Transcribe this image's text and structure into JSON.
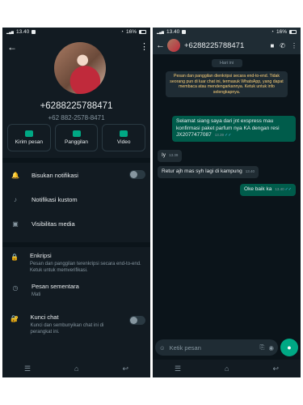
{
  "left": {
    "status": {
      "time": "13.40",
      "battery": "16%"
    },
    "contact": {
      "phone": "+6288225788471",
      "phone_alt": "+62 882-2578-8471"
    },
    "actions": [
      {
        "label": "Kirim pesan",
        "icon": "message-icon"
      },
      {
        "label": "Panggilan",
        "icon": "phone-icon"
      },
      {
        "label": "Video",
        "icon": "video-icon"
      }
    ],
    "settings": [
      {
        "label": "Bisukan notifikasi",
        "icon": "bell-icon",
        "toggle": true
      },
      {
        "label": "Notifikasi kustom",
        "icon": "music-note-icon"
      },
      {
        "label": "Visibilitas media",
        "icon": "image-icon"
      }
    ],
    "security": [
      {
        "label": "Enkripsi",
        "sub": "Pesan dan panggilan terenkripsi secara end-to-end. Ketuk untuk memverifikasi.",
        "icon": "lock-icon"
      },
      {
        "label": "Pesan sementara",
        "sub": "Mati",
        "icon": "timer-icon"
      },
      {
        "label": "Kunci chat",
        "sub": "Kunci dan sembunyikan chat ini di perangkat ini.",
        "icon": "chat-lock-icon",
        "toggle": true
      }
    ]
  },
  "right": {
    "status": {
      "time": "13.40",
      "battery": "16%"
    },
    "header": {
      "name": "+6288225788471"
    },
    "day_label": "Hari ini",
    "e2e_notice": "Pesan dan panggilan dienkripsi secara end-to-end. Tidak seorang pun di luar chat ini, termasuk WhatsApp, yang dapat membaca atau mendengarkannya. Ketuk untuk info selengkapnya.",
    "messages": [
      {
        "dir": "out",
        "text": "Selamat siang saya dari jnt exspress mau konfirmasi paket parfum nya KA dengan resi JX2077477087",
        "time": "13.39"
      },
      {
        "dir": "in",
        "text": "Iy",
        "time": "13.39"
      },
      {
        "dir": "in",
        "text": "Retur ajh mas syh lagi di kampung",
        "time": "13.40"
      },
      {
        "dir": "out",
        "text": "Oke baik ka",
        "time": "13.40"
      }
    ],
    "composer": {
      "placeholder": "Ketik pesan"
    }
  }
}
